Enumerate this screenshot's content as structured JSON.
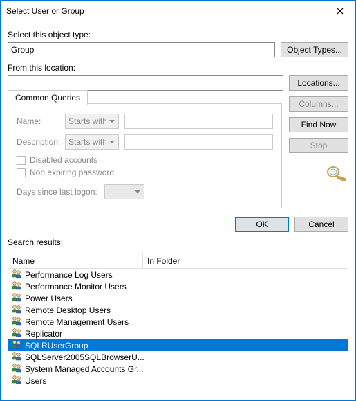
{
  "window": {
    "title": "Select User or Group"
  },
  "object_type": {
    "label": "Select this object type:",
    "value": "Group",
    "button": "Object Types..."
  },
  "location": {
    "label": "From this location:",
    "value": "",
    "button": "Locations..."
  },
  "queries": {
    "tab": "Common Queries",
    "name_label": "Name:",
    "name_mode": "Starts with",
    "name_value": "",
    "desc_label": "Description:",
    "desc_mode": "Starts with",
    "desc_value": "",
    "disabled_accounts": "Disabled accounts",
    "non_expiring": "Non expiring password",
    "days_label": "Days since last logon:"
  },
  "side_buttons": {
    "columns": "Columns...",
    "find_now": "Find Now",
    "stop": "Stop"
  },
  "actions": {
    "ok": "OK",
    "cancel": "Cancel"
  },
  "results": {
    "label": "Search results:",
    "col_name": "Name",
    "col_folder": "In Folder",
    "items": [
      {
        "name": "Performance Log Users",
        "selected": false
      },
      {
        "name": "Performance Monitor Users",
        "selected": false
      },
      {
        "name": "Power Users",
        "selected": false
      },
      {
        "name": "Remote Desktop Users",
        "selected": false
      },
      {
        "name": "Remote Management Users",
        "selected": false
      },
      {
        "name": "Replicator",
        "selected": false
      },
      {
        "name": "SQLRUserGroup",
        "selected": true
      },
      {
        "name": "SQLServer2005SQLBrowserU...",
        "selected": false
      },
      {
        "name": "System Managed Accounts Gr...",
        "selected": false
      },
      {
        "name": "Users",
        "selected": false
      }
    ]
  }
}
